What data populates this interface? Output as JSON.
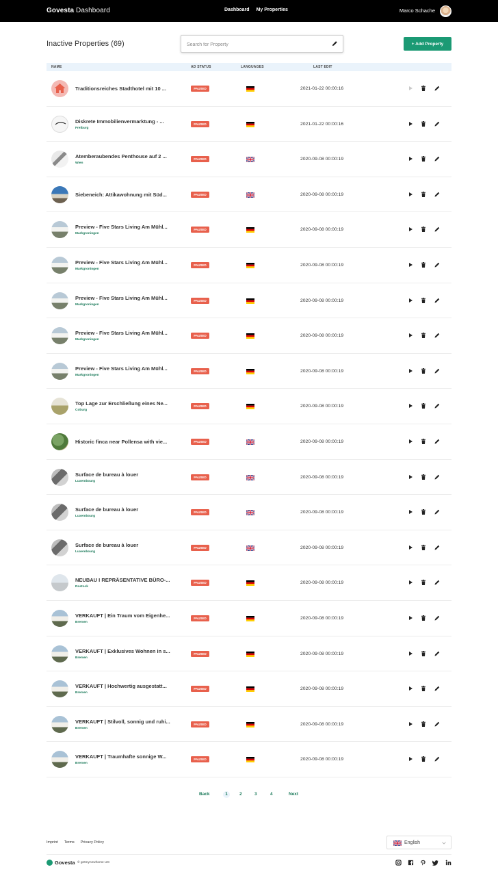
{
  "header": {
    "brand_bold": "Govesta",
    "brand_light": " Dashboard",
    "nav": [
      "Dashboard",
      "My Properties"
    ],
    "user_name": "Marco Schache"
  },
  "toolbar": {
    "title": "Inactive Properties (69)",
    "search_placeholder": "Search for Property",
    "add_label": "+ Add Property"
  },
  "table": {
    "columns": [
      "NAME",
      "AD STATUS",
      "LANGUAGES",
      "LAST EDIT"
    ],
    "rows": [
      {
        "name": "Traditionsreiches Stadthotel mit 10 ...",
        "city": "",
        "status": "PAUSED",
        "lang": "de",
        "date": "2021-01-22 00:00:16",
        "thumb": "home"
      },
      {
        "name": "Diskrete Immobilienvermarktung - ...",
        "city": "Freiburg",
        "status": "PAUSED",
        "lang": "de",
        "date": "2021-01-22 00:00:16",
        "thumb": "logo"
      },
      {
        "name": "Atemberaubendes Penthouse auf 2 ...",
        "city": "Wien",
        "status": "PAUSED",
        "lang": "en",
        "date": "2020-09-08 00:00:19",
        "thumb": "interior"
      },
      {
        "name": "Siebeneich: Attikawohnung mit Süd...",
        "city": "",
        "status": "PAUSED",
        "lang": "en",
        "date": "2020-09-08 00:00:19",
        "thumb": "sky"
      },
      {
        "name": "Preview - Five Stars Living Am Mühl...",
        "city": "Markgroningen",
        "status": "PAUSED",
        "lang": "de",
        "date": "2020-09-08 00:00:19",
        "thumb": "building"
      },
      {
        "name": "Preview - Five Stars Living Am Mühl...",
        "city": "Markgroningen",
        "status": "PAUSED",
        "lang": "de",
        "date": "2020-09-08 00:00:19",
        "thumb": "building"
      },
      {
        "name": "Preview - Five Stars Living Am Mühl...",
        "city": "Markgroningen",
        "status": "PAUSED",
        "lang": "de",
        "date": "2020-09-08 00:00:19",
        "thumb": "building"
      },
      {
        "name": "Preview - Five Stars Living Am Mühl...",
        "city": "Markgroningen",
        "status": "PAUSED",
        "lang": "de",
        "date": "2020-09-08 00:00:19",
        "thumb": "building"
      },
      {
        "name": "Preview - Five Stars Living Am Mühl...",
        "city": "Markgroningen",
        "status": "PAUSED",
        "lang": "de",
        "date": "2020-09-08 00:00:19",
        "thumb": "building"
      },
      {
        "name": "Top Lage zur Erschließung eines Ne...",
        "city": "Coburg",
        "status": "PAUSED",
        "lang": "de",
        "date": "2020-09-08 00:00:19",
        "thumb": "field"
      },
      {
        "name": "Historic finca near Pollensa with vie...",
        "city": "",
        "status": "PAUSED",
        "lang": "en",
        "date": "2020-09-08 00:00:19",
        "thumb": "green"
      },
      {
        "name": "Surface de bureau à louer",
        "city": "Luxembourg",
        "status": "PAUSED",
        "lang": "en",
        "date": "2020-09-08 00:00:19",
        "thumb": "grey"
      },
      {
        "name": "Surface de bureau à louer",
        "city": "Luxembourg",
        "status": "PAUSED",
        "lang": "en",
        "date": "2020-09-08 00:00:19",
        "thumb": "grey"
      },
      {
        "name": "Surface de bureau à louer",
        "city": "Luxembourg",
        "status": "PAUSED",
        "lang": "en",
        "date": "2020-09-08 00:00:19",
        "thumb": "grey"
      },
      {
        "name": "NEUBAU I REPRÄSENTATIVE BÜRO-...",
        "city": "Rostock",
        "status": "PAUSED",
        "lang": "de",
        "date": "2020-09-08 00:00:19",
        "thumb": "pale"
      },
      {
        "name": "VERKAUFT | Ein Traum vom Eigenhe...",
        "city": "Bremen",
        "status": "PAUSED",
        "lang": "de",
        "date": "2020-09-08 00:00:19",
        "thumb": "house"
      },
      {
        "name": "VERKAUFT | Exklusives Wohnen in s...",
        "city": "Bremen",
        "status": "PAUSED",
        "lang": "de",
        "date": "2020-09-08 00:00:19",
        "thumb": "house"
      },
      {
        "name": "VERKAUFT | Hochwertig ausgestatt...",
        "city": "Bremen",
        "status": "PAUSED",
        "lang": "de",
        "date": "2020-09-08 00:00:19",
        "thumb": "house"
      },
      {
        "name": "VERKAUFT | Stilvoll, sonnig und ruhi...",
        "city": "Bremen",
        "status": "PAUSED",
        "lang": "de",
        "date": "2020-09-08 00:00:19",
        "thumb": "house"
      },
      {
        "name": "VERKAUFT | Traumhafte sonnige W...",
        "city": "Bremen",
        "status": "PAUSED",
        "lang": "de",
        "date": "2020-09-08 00:00:19",
        "thumb": "house"
      }
    ]
  },
  "pagination": {
    "back": "Back",
    "pages": [
      "1",
      "2",
      "3",
      "4"
    ],
    "current": "1",
    "next": "Next"
  },
  "footer": {
    "links": [
      "Imprint",
      "Terms",
      "Privacy Policy"
    ],
    "language": "English",
    "brand": "Govesta",
    "copyright": "© getmynewhome UG",
    "social": [
      "instagram-icon",
      "facebook-icon",
      "pinterest-icon",
      "twitter-icon",
      "linkedin-icon"
    ]
  },
  "colors": {
    "accent": "#1b9a74",
    "badge": "#e8604c",
    "topbar": "#000000"
  }
}
